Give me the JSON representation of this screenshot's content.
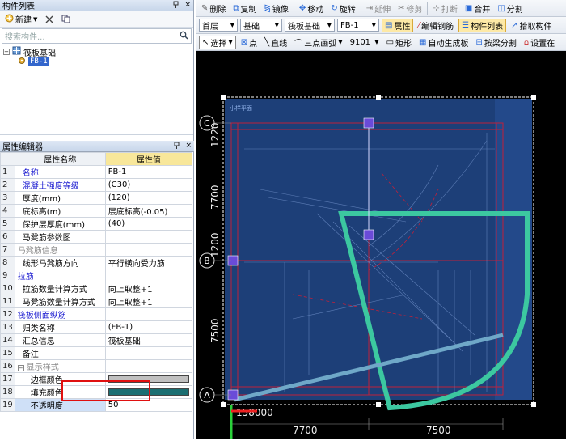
{
  "left": {
    "comp_list_title": "构件列表",
    "pin_icon": "pin",
    "close_icon": "×",
    "new_label": "新建",
    "search_placeholder": "搜索构件...",
    "tree_root": "筏板基础",
    "tree_child": "FB-1",
    "prop_title": "属性编辑器",
    "prop_header_name": "属性名称",
    "prop_header_value": "属性值",
    "props": [
      {
        "n": "1",
        "name": "名称",
        "value": "FB-1",
        "style": "cat"
      },
      {
        "n": "2",
        "name": "混凝土强度等级",
        "value": "(C30)",
        "style": "cat"
      },
      {
        "n": "3",
        "name": "厚度(mm)",
        "value": "(120)",
        "style": ""
      },
      {
        "n": "4",
        "name": "底标高(m)",
        "value": "层底标高(-0.05)",
        "style": ""
      },
      {
        "n": "5",
        "name": "保护层厚度(mm)",
        "value": "(40)",
        "style": ""
      },
      {
        "n": "6",
        "name": "马凳筋参数图",
        "value": "",
        "style": ""
      },
      {
        "n": "7",
        "name": "马凳筋信息",
        "value": "",
        "style": "gray"
      },
      {
        "n": "8",
        "name": "线形马凳筋方向",
        "value": "平行横向受力筋",
        "style": ""
      },
      {
        "n": "9",
        "name": "拉筋",
        "value": "",
        "style": "cat"
      },
      {
        "n": "10",
        "name": "拉筋数量计算方式",
        "value": "向上取整+1",
        "style": ""
      },
      {
        "n": "11",
        "name": "马凳筋数量计算方式",
        "value": "向上取整+1",
        "style": ""
      },
      {
        "n": "12",
        "name": "筏板侧面纵筋",
        "value": "",
        "style": "cat"
      },
      {
        "n": "13",
        "name": "归类名称",
        "value": "(FB-1)",
        "style": ""
      },
      {
        "n": "14",
        "name": "汇总信息",
        "value": "筏板基础",
        "style": ""
      },
      {
        "n": "15",
        "name": "备注",
        "value": "",
        "style": ""
      },
      {
        "n": "16",
        "name": "显示样式",
        "value": "",
        "style": "gray"
      },
      {
        "n": "17",
        "name": "边框颜色",
        "value": "",
        "style": ""
      },
      {
        "n": "18",
        "name": "填充颜色",
        "value": "",
        "style": ""
      },
      {
        "n": "19",
        "name": "不透明度",
        "value": "50",
        "style": ""
      }
    ],
    "border_color_swatch": "#c0c0c0",
    "fill_color_swatch": "#1a6e72",
    "expand_minus": "−"
  },
  "toolbar1": {
    "delete": "删除",
    "copy": "复制",
    "mirror": "镜像",
    "move": "移动",
    "rotate": "旋转",
    "extend": "延伸",
    "trim": "修剪",
    "break": "打断",
    "merge": "合并",
    "split": "分割"
  },
  "toolbar2": {
    "floor": "首层",
    "category": "基础",
    "type": "筏板基础",
    "component": "FB-1",
    "property": "属性",
    "edit_rebar": "编辑钢筋",
    "comp_list": "构件列表",
    "pick_comp": "拾取构件"
  },
  "toolbar3": {
    "select": "选择",
    "point": "点",
    "line": "直线",
    "arc": "三点画弧",
    "arc_value": "9101",
    "rect": "矩形",
    "auto_gen": "自动生成板",
    "by_beam_split": "按梁分割",
    "settings": "设置在"
  },
  "canvas": {
    "axis_c": "C",
    "axis_b": "B",
    "axis_a": "A",
    "dim_1220": "1220",
    "dim_7700_v": "7700",
    "dim_1200": "1200",
    "dim_7500_v": "7500",
    "dim_158000": "158000",
    "dim_7700_h": "7700",
    "dim_7500_h": "7500",
    "frame_label": "小样平面",
    "accent_teal": "#3cc8a0",
    "grid_red": "#c0203a",
    "highlight_red": "#e01010"
  }
}
